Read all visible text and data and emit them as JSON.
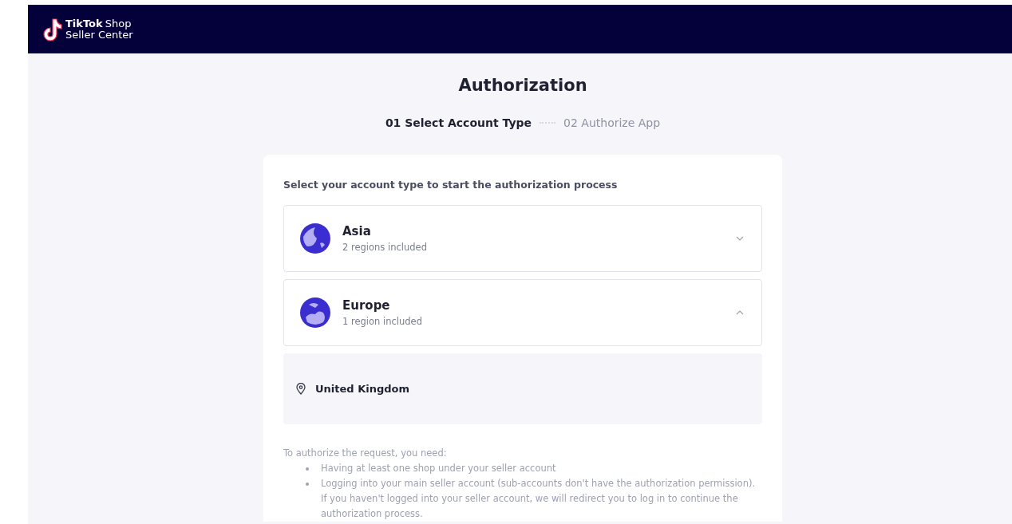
{
  "header": {
    "logo_brand": "TikTok",
    "logo_product": "Shop",
    "logo_subtitle": "Seller Center"
  },
  "title": "Authorization",
  "steps": [
    {
      "label": "01 Select Account Type",
      "selected": true
    },
    {
      "label": "02 Authorize App",
      "selected": false
    }
  ],
  "card": {
    "heading": "Select your account type to start the authorization process",
    "regions": [
      {
        "name": "Asia",
        "subtitle": "2 regions included",
        "expanded": false
      },
      {
        "name": "Europe",
        "subtitle": "1 region included",
        "expanded": true,
        "countries": [
          "United Kingdom"
        ]
      }
    ],
    "requirements": {
      "intro": "To authorize the request, you need:",
      "items": [
        "Having at least one shop under your seller account",
        "Logging into your main seller account (sub-accounts don't have the authorization permission). If you haven't logged into your seller account, we will redirect you to log in to continue the authorization process."
      ]
    }
  }
}
